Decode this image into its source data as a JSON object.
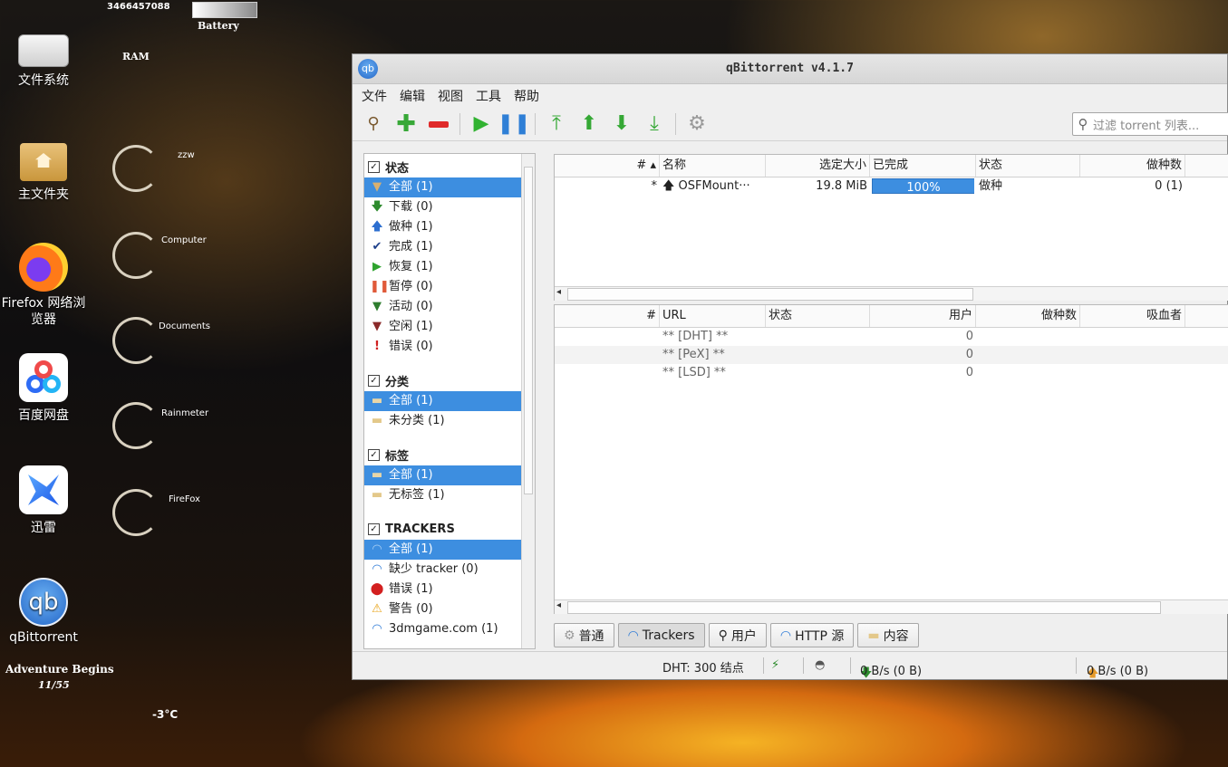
{
  "desktop": {
    "widget_number": "3466457088",
    "widget_battery": "Battery",
    "widget_ram": "RAM",
    "icons": [
      {
        "label": "文件系统",
        "icon": "drive-icon"
      },
      {
        "label": "主文件夹",
        "icon": "home-folder-icon"
      },
      {
        "label": "Firefox 网络浏览器",
        "icon": "firefox-icon"
      },
      {
        "label": "百度网盘",
        "icon": "baidu-netdisk-icon"
      },
      {
        "label": "迅雷",
        "icon": "xunlei-icon"
      },
      {
        "label": "qBittorrent",
        "icon": "qbittorrent-icon"
      }
    ],
    "gauges": [
      "zzw",
      "Computer",
      "Documents",
      "Rainmeter",
      "FireFox"
    ],
    "adventure_text": "Adventure Begins",
    "adventure_sub": "11/55",
    "temperature": "-3°C"
  },
  "window": {
    "title": "qBittorrent v4.1.7",
    "app_icon_text": "qb",
    "menu": [
      "文件",
      "编辑",
      "视图",
      "工具",
      "帮助"
    ],
    "search_placeholder": "过滤 torrent 列表..."
  },
  "sidebar": {
    "status_header": "状态",
    "status_items": [
      {
        "label": "全部 (1)",
        "icon": "funnel-icon",
        "color": "#b08040",
        "selected": true
      },
      {
        "label": "下载 (0)",
        "icon": "arrow-down-icon",
        "color": "#2e8b2e"
      },
      {
        "label": "做种 (1)",
        "icon": "arrow-up-icon",
        "color": "#2d6fd0"
      },
      {
        "label": "完成 (1)",
        "icon": "checkmark-icon",
        "color": "#1d3f8a"
      },
      {
        "label": "恢复 (1)",
        "icon": "play-icon",
        "color": "#2fa32f"
      },
      {
        "label": "暂停 (0)",
        "icon": "pause-icon",
        "color": "#e05a3a"
      },
      {
        "label": "活动 (0)",
        "icon": "funnel-icon",
        "color": "#2e7d2e"
      },
      {
        "label": "空闲 (1)",
        "icon": "funnel-icon",
        "color": "#8a2a2a"
      },
      {
        "label": "错误 (0)",
        "icon": "exclamation-icon",
        "color": "#d02020"
      }
    ],
    "category_header": "分类",
    "category_items": [
      {
        "label": "全部 (1)",
        "selected": true
      },
      {
        "label": "未分类 (1)"
      }
    ],
    "tag_header": "标签",
    "tag_items": [
      {
        "label": "全部 (1)",
        "selected": true
      },
      {
        "label": "无标签 (1)"
      }
    ],
    "tracker_header": "TRACKERS",
    "tracker_items": [
      {
        "label": "全部 (1)",
        "icon": "wifi-icon",
        "selected": true
      },
      {
        "label": "缺少 tracker (0)",
        "icon": "wifi-icon"
      },
      {
        "label": "错误 (1)",
        "icon": "error-circle-icon"
      },
      {
        "label": "警告 (0)",
        "icon": "warning-icon"
      },
      {
        "label": "3dmgame.com (1)",
        "icon": "wifi-icon"
      }
    ]
  },
  "torrent_table": {
    "columns": [
      "#",
      "名称",
      "选定大小",
      "已完成",
      "状态",
      "做种数"
    ],
    "rows": [
      {
        "num": "*",
        "name": "OSFMount···",
        "size": "19.8 MiB",
        "progress": "100%",
        "progress_value": 1.0,
        "status": "做种",
        "seeds": "0 (1)"
      }
    ]
  },
  "tracker_table": {
    "columns": [
      "#",
      "URL",
      "状态",
      "用户",
      "做种数",
      "吸血者"
    ],
    "rows": [
      {
        "url": "** [DHT] **",
        "users": "0"
      },
      {
        "url": "** [PeX] **",
        "users": "0"
      },
      {
        "url": "** [LSD] **",
        "users": "0"
      }
    ]
  },
  "tabs": [
    {
      "label": "普通",
      "icon": "gear-icon"
    },
    {
      "label": "Trackers",
      "icon": "wifi-icon",
      "active": true
    },
    {
      "label": "用户",
      "icon": "search-icon"
    },
    {
      "label": "HTTP 源",
      "icon": "wifi-icon"
    },
    {
      "label": "内容",
      "icon": "folder-icon"
    }
  ],
  "statusbar": {
    "dht": "DHT: 300 结点",
    "download": "0 B/s (0 B)",
    "upload": "0 B/s (0 B)"
  }
}
